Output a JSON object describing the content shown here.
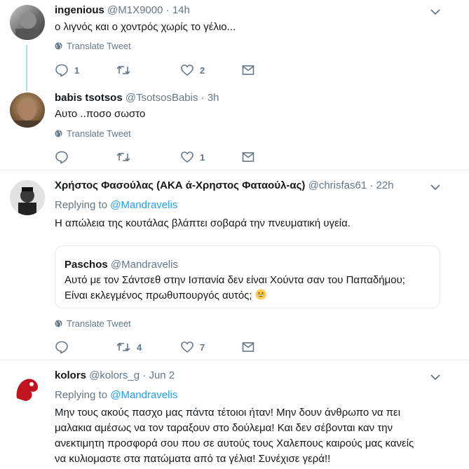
{
  "tweets": [
    {
      "name": "ingenious",
      "handle": "@M1X9000",
      "dot": "·",
      "time": "14h",
      "text": "ο λιγνός και ο χοντρός χωρίς το γέλιο...",
      "translate": "Translate Tweet",
      "replies": "1",
      "retweets": "",
      "likes": "2"
    },
    {
      "name": "babis tsotsos",
      "handle": "@TsotsosBabis",
      "dot": "·",
      "time": "3h",
      "text": "Αυτο ..ποσο σωστο",
      "translate": "Translate Tweet",
      "replies": "",
      "retweets": "",
      "likes": "1"
    },
    {
      "name": "Χρήστος Φασούλας (ΑΚΑ ά-Χρηστος Φαταούλ-ας)",
      "handle": "@chrisfas61",
      "dot": "·",
      "time": "22h",
      "replying_prefix": "Replying to",
      "replying_to": "@Mandravelis",
      "text": "Η απώλεια της κουτάλας βλάπτει σοβαρά την πνευματική υγεία.",
      "quote": {
        "name": "Paschos",
        "handle": "@Mandravelis",
        "line1": "Αυτό με τον Σάντσεθ στην Ισπανία δεν είναι Χούντα σαν του Παπαδήμου;",
        "line2": "Είναι εκλεγμένος πρωθυπουργός αυτός;"
      },
      "translate": "Translate Tweet",
      "replies": "",
      "retweets": "4",
      "likes": "7"
    },
    {
      "name": "kolors",
      "handle": "@kolors_g",
      "dot": "·",
      "time": "Jun 2",
      "replying_prefix": "Replying to",
      "replying_to": "@Mandravelis",
      "lines": [
        "Μην τους ακούς πασχο μας πάντα τέτοιοι ήταν! Μην δουν άνθρωπο να πει",
        "μαλακια αμέσως να τον ταραξουν στο δούλεμα! Και δεν σέβονται καν την",
        "ανεκτιμητη προσφορά σου  που σε αυτούς τους Χαλεπους καιρούς μας κανείς",
        "να κυλιομαστε στα πατώματα από τα γέλια! Συνέχισε γερά!!"
      ]
    }
  ],
  "colors": {
    "link": "#1da1f2",
    "muted": "#657786",
    "border": "#e6ecf0",
    "thread": "#a9dcf7"
  },
  "icons": [
    "chevron-down-icon",
    "globe-icon",
    "reply-icon",
    "retweet-icon",
    "like-icon",
    "mail-icon",
    "grinning-emoji-icon"
  ]
}
